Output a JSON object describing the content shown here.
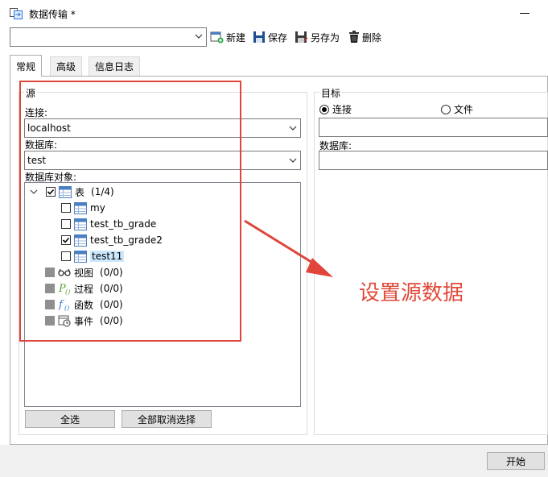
{
  "window": {
    "title": "数据传输 *"
  },
  "toolbar": {
    "profile_value": "",
    "new_label": "新建",
    "save_label": "保存",
    "save_as_label": "另存为",
    "delete_label": "删除"
  },
  "tabs": [
    {
      "label": "常规",
      "active": true
    },
    {
      "label": "高级",
      "active": false
    },
    {
      "label": "信息日志",
      "active": false
    }
  ],
  "source": {
    "group_title": "源",
    "connection_label": "连接:",
    "connection_value": "localhost",
    "database_label": "数据库:",
    "database_value": "test",
    "objects_label": "数据库对象:",
    "tree": {
      "tables_label": "表",
      "tables_count": "(1/4)",
      "tables": [
        {
          "name": "my",
          "checked": false
        },
        {
          "name": "test_tb_grade",
          "checked": false
        },
        {
          "name": "test_tb_grade2",
          "checked": true
        },
        {
          "name": "test11",
          "checked": false,
          "selected": true
        }
      ],
      "views_label": "视图",
      "views_count": "(0/0)",
      "procedures_label": "过程",
      "procedures_count": "(0/0)",
      "functions_label": "函数",
      "functions_count": "(0/0)",
      "events_label": "事件",
      "events_count": "(0/0)"
    },
    "select_all_label": "全选",
    "deselect_all_label": "全部取消选择"
  },
  "target": {
    "group_title": "目标",
    "radio_connection_label": "连接",
    "radio_file_label": "文件",
    "selected_radio": "connection",
    "connection_value": "",
    "database_label": "数据库:",
    "database_value": ""
  },
  "annotation": {
    "text": "设置源数据",
    "color": "#e04a3a"
  },
  "footer": {
    "start_label": "开始"
  }
}
